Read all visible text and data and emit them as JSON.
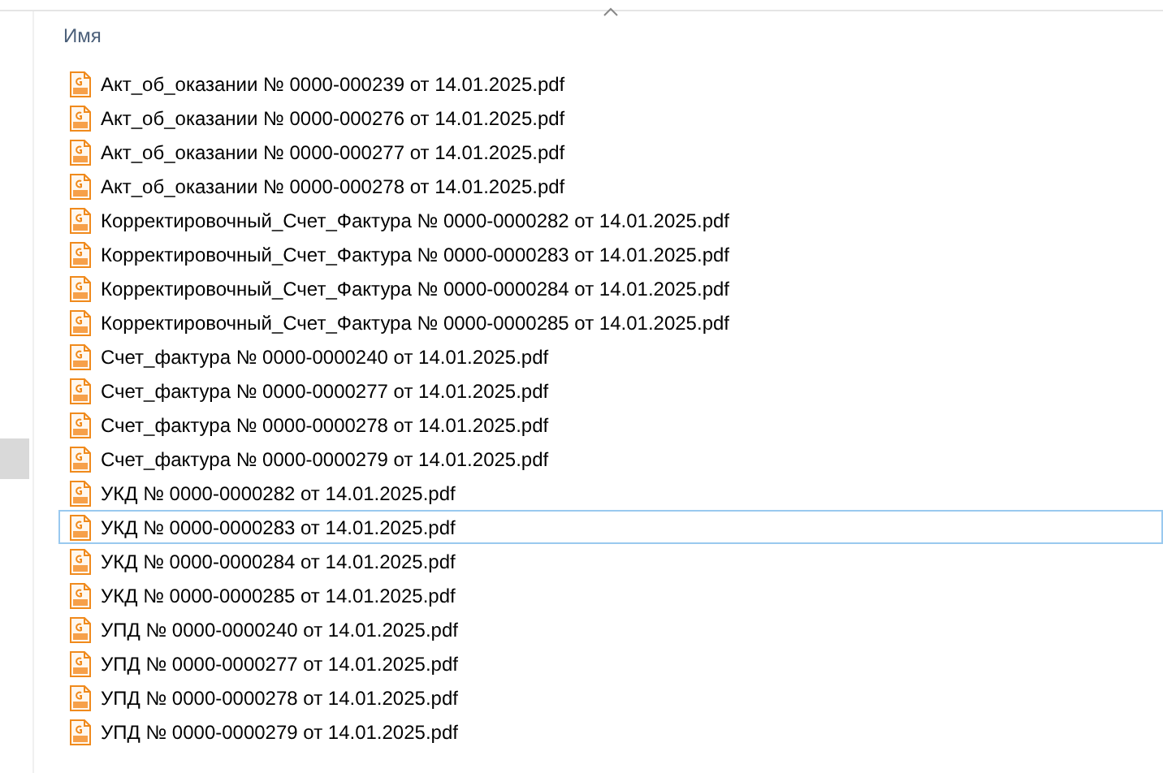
{
  "header": {
    "columns": [
      {
        "label": "Имя",
        "sorted": true
      }
    ]
  },
  "files": [
    {
      "name": "Акт_об_оказании № 0000-000239 от 14.01.2025.pdf",
      "focused": false
    },
    {
      "name": "Акт_об_оказании № 0000-000276 от 14.01.2025.pdf",
      "focused": false
    },
    {
      "name": "Акт_об_оказании № 0000-000277 от 14.01.2025.pdf",
      "focused": false
    },
    {
      "name": "Акт_об_оказании № 0000-000278 от 14.01.2025.pdf",
      "focused": false
    },
    {
      "name": "Корректировочный_Счет_Фактура № 0000-0000282 от 14.01.2025.pdf",
      "focused": false
    },
    {
      "name": "Корректировочный_Счет_Фактура № 0000-0000283 от 14.01.2025.pdf",
      "focused": false
    },
    {
      "name": "Корректировочный_Счет_Фактура № 0000-0000284 от 14.01.2025.pdf",
      "focused": false
    },
    {
      "name": "Корректировочный_Счет_Фактура № 0000-0000285 от 14.01.2025.pdf",
      "focused": false
    },
    {
      "name": "Счет_фактура № 0000-0000240 от 14.01.2025.pdf",
      "focused": false
    },
    {
      "name": "Счет_фактура № 0000-0000277 от 14.01.2025.pdf",
      "focused": false
    },
    {
      "name": "Счет_фактура № 0000-0000278 от 14.01.2025.pdf",
      "focused": false
    },
    {
      "name": "Счет_фактура № 0000-0000279 от 14.01.2025.pdf",
      "focused": false
    },
    {
      "name": "УКД № 0000-0000282 от 14.01.2025.pdf",
      "focused": false
    },
    {
      "name": "УКД № 0000-0000283 от 14.01.2025.pdf",
      "focused": true
    },
    {
      "name": "УКД № 0000-0000284 от 14.01.2025.pdf",
      "focused": false
    },
    {
      "name": "УКД № 0000-0000285 от 14.01.2025.pdf",
      "focused": false
    },
    {
      "name": "УПД № 0000-0000240 от 14.01.2025.pdf",
      "focused": false
    },
    {
      "name": "УПД № 0000-0000277 от 14.01.2025.pdf",
      "focused": false
    },
    {
      "name": "УПД № 0000-0000278 от 14.01.2025.pdf",
      "focused": false
    },
    {
      "name": "УПД № 0000-0000279 от 14.01.2025.pdf",
      "focused": false
    }
  ]
}
